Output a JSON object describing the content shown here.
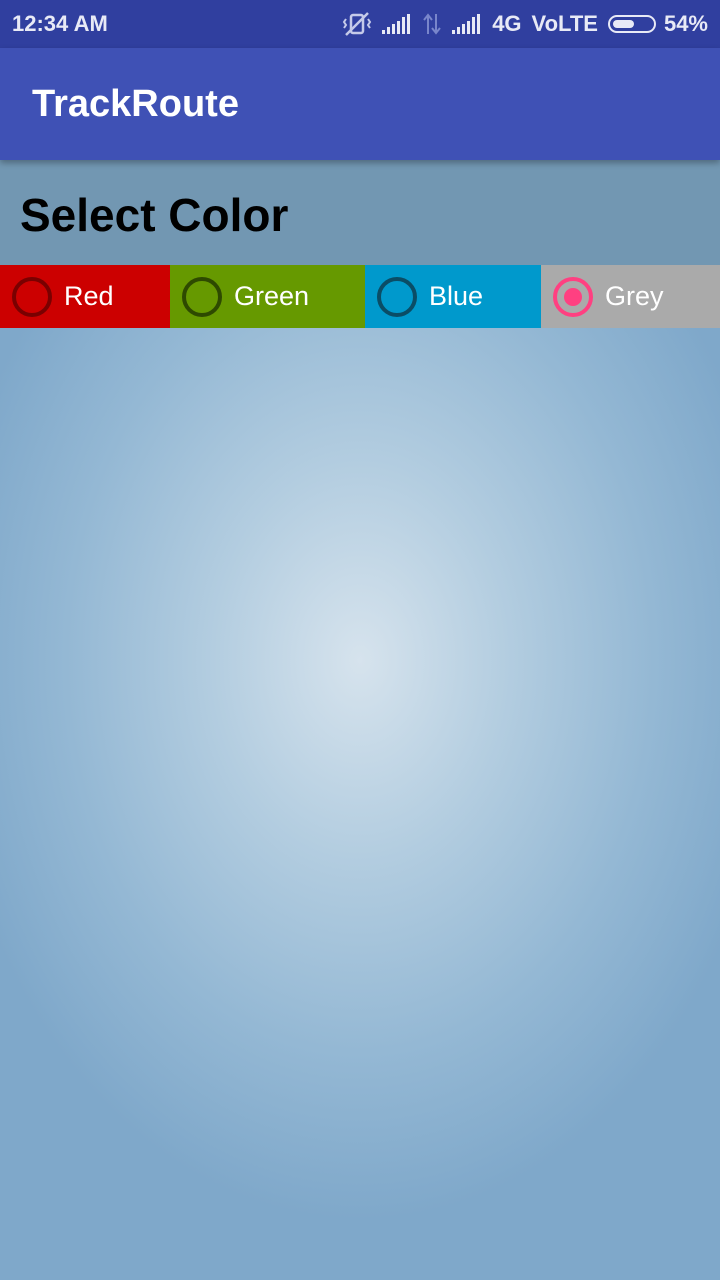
{
  "status_bar": {
    "time": "12:34 AM",
    "network": "4G",
    "volte": "VoLTE",
    "battery_percent": "54%",
    "battery_level": 0.54,
    "icons": [
      "vibrate-off-icon",
      "signal-icon",
      "data-arrows-icon",
      "signal-icon"
    ]
  },
  "app_bar": {
    "title": "TrackRoute",
    "color": "#3f51b5"
  },
  "header": {
    "title": "Select Color",
    "background": "#7297b2"
  },
  "color_options": [
    {
      "label": "Red",
      "background": "#cc0000",
      "ring": "#7a0000",
      "selected": false
    },
    {
      "label": "Green",
      "background": "#669900",
      "ring": "#2e4a00",
      "selected": false
    },
    {
      "label": "Blue",
      "background": "#0099cc",
      "ring": "#0a4d66",
      "selected": false
    },
    {
      "label": "Grey",
      "background": "#aaaaaa",
      "ring": "#ff4081",
      "selected": true
    }
  ]
}
